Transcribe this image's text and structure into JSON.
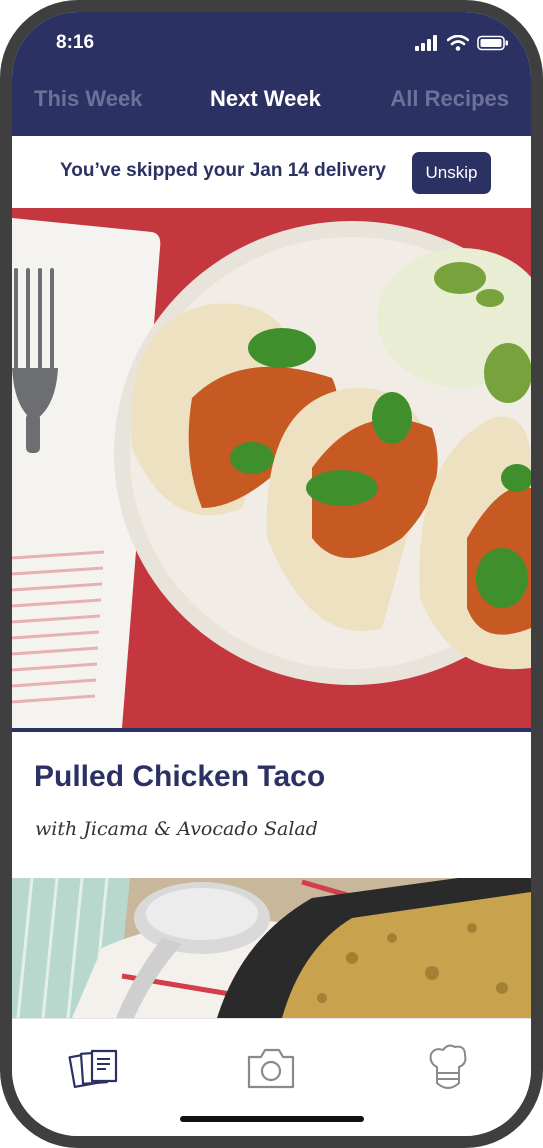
{
  "status_bar": {
    "time": "8:16",
    "icons": [
      "signal-icon",
      "wifi-icon",
      "battery-icon"
    ]
  },
  "tabs": [
    {
      "label": "This Week",
      "active": false
    },
    {
      "label": "Next Week",
      "active": true
    },
    {
      "label": "All Recipes",
      "active": false
    }
  ],
  "banner": {
    "message": "You’ve skipped your Jan 14 delivery",
    "button_label": "Unskip"
  },
  "recipe": {
    "title": "Pulled Chicken Taco",
    "subtitle": "with Jicama & Avocado Salad"
  },
  "bottom_nav": {
    "items": [
      {
        "icon": "recipe-cards-icon",
        "active": true
      },
      {
        "icon": "camera-icon",
        "active": false
      },
      {
        "icon": "chef-hat-icon",
        "active": false
      }
    ]
  },
  "colors": {
    "brand_navy": "#2b3162",
    "inactive_tab": "#6c719a",
    "tablecloth_red": "#c9383f"
  }
}
